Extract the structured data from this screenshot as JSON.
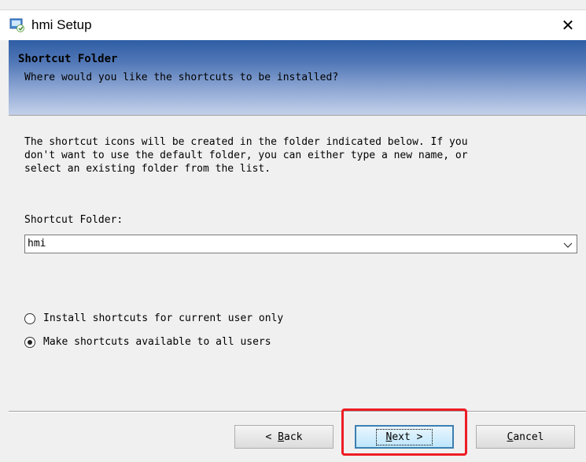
{
  "window": {
    "title": "hmi Setup",
    "close_symbol": "✕",
    "icon": "installer-icon"
  },
  "header": {
    "title": "Shortcut Folder",
    "subtitle": "Where would you like the shortcuts to be installed?"
  },
  "body": {
    "description": "The shortcut icons will be created in the folder indicated below. If you\ndon't want to use the default folder, you can either type a new name, or\nselect an existing folder from the list."
  },
  "folder": {
    "label": "Shortcut Folder:",
    "value": "hmi"
  },
  "options": [
    {
      "label": "Install shortcuts for current user only",
      "checked": false
    },
    {
      "label": "Make shortcuts available to all users",
      "checked": true
    }
  ],
  "buttons": {
    "back": {
      "prefix": "< ",
      "mnemonic": "B",
      "rest": "ack"
    },
    "next": {
      "mnemonic": "N",
      "rest": "ext >"
    },
    "cancel": {
      "mnemonic": "C",
      "rest": "ancel"
    }
  },
  "colors": {
    "highlight": "#ee1c24",
    "header_gradient_top": "#2f5ea5"
  }
}
